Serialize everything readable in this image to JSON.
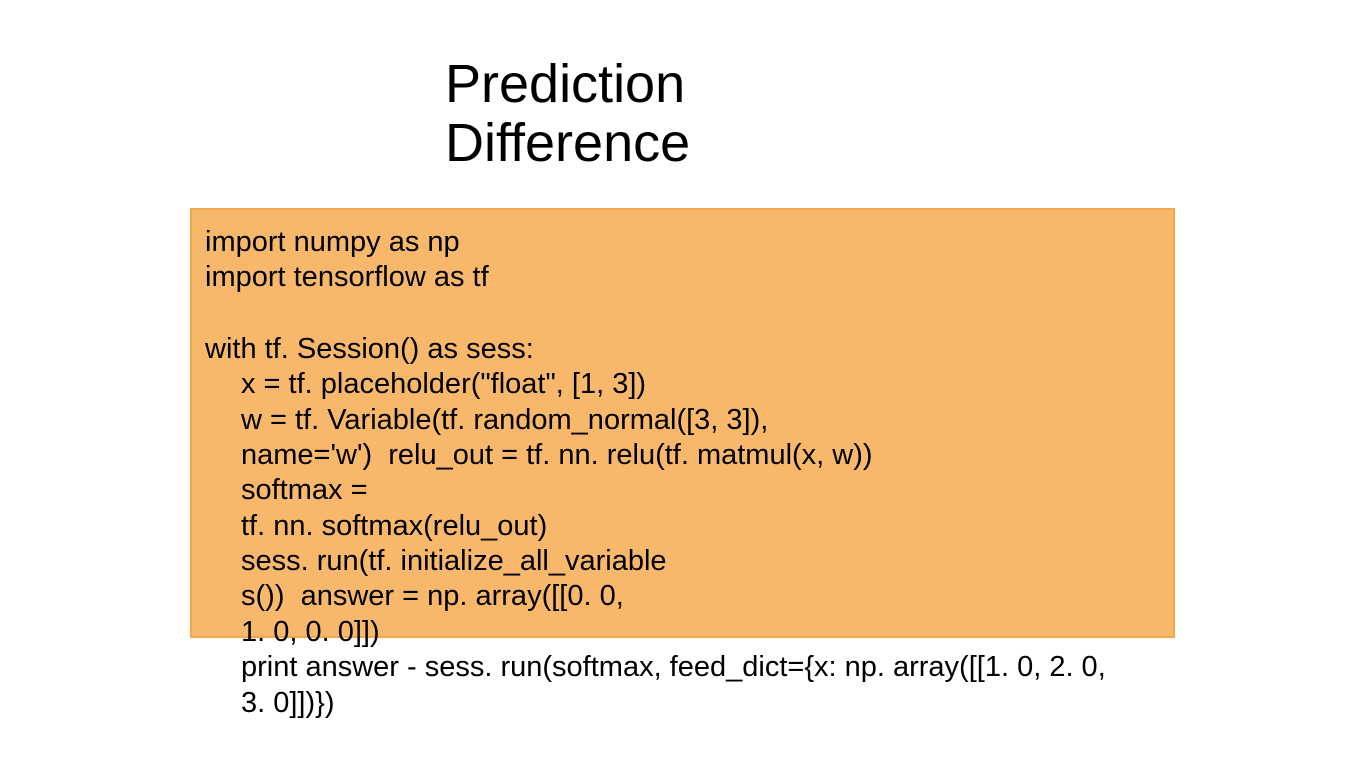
{
  "title_line1": "Prediction",
  "title_line2": "Difference",
  "code": {
    "l1": "import numpy as np",
    "l2": "import tensorflow as tf",
    "l3": "with tf. Session() as sess:",
    "l4": "x = tf. placeholder(\"float\", [1, 3])",
    "l5": "w = tf. Variable(tf. random_normal([3, 3]),",
    "l6": "name='w')  relu_out = tf. nn. relu(tf. matmul(x, w))",
    "l7": "softmax =",
    "l8": "tf. nn. softmax(relu_out)",
    "l9": "sess. run(tf. initialize_all_variable",
    "l10": "s())  answer = np. array([[0. 0,",
    "l11": "1. 0, 0. 0]])",
    "l12": "print answer - sess. run(softmax, feed_dict={x: np. array([[1. 0, 2. 0,",
    "l13": "3. 0]])})"
  }
}
